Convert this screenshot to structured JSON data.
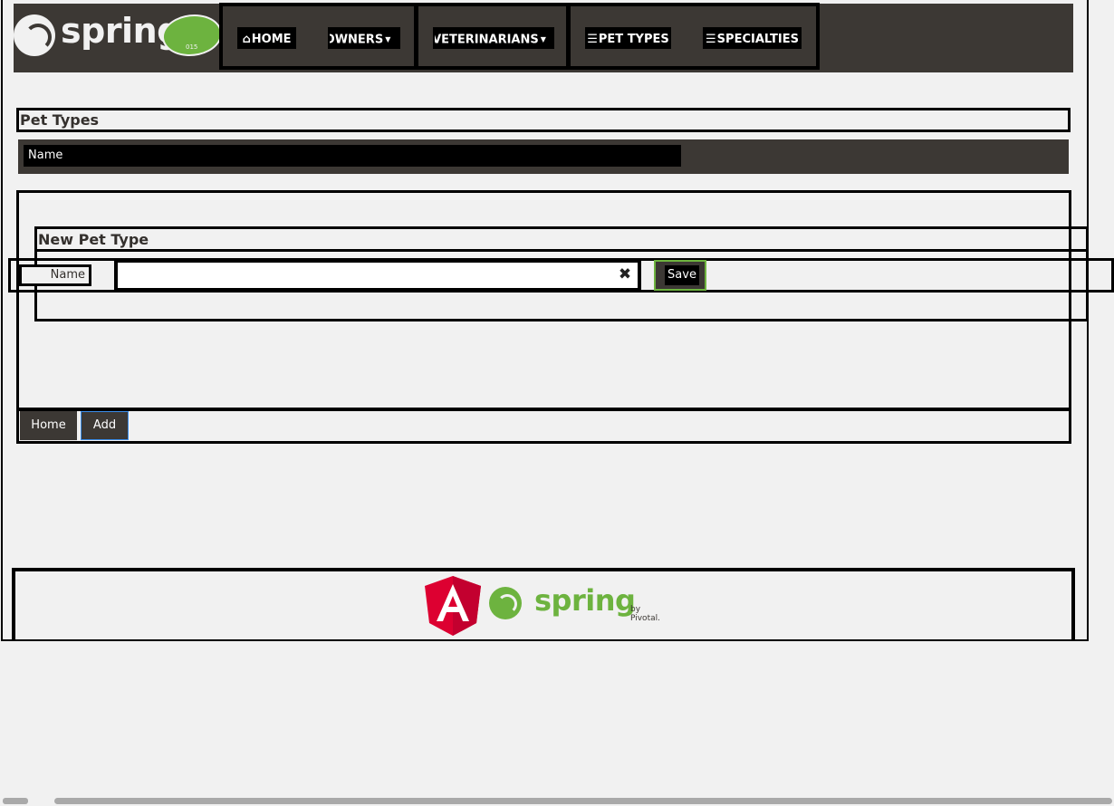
{
  "brand": {
    "name": "spring",
    "leaf_text": "015",
    "leaf_color": "#6db33f"
  },
  "nav": {
    "items": [
      {
        "label": "HOME",
        "icon": "home-icon"
      },
      {
        "label": "OWNERS",
        "icon": "chevron-down-icon"
      },
      {
        "label": "VETERINARIANS",
        "icon": "chevron-down-icon"
      },
      {
        "label": "PET TYPES",
        "icon": "list-icon"
      },
      {
        "label": "SPECIALTIES",
        "icon": "list-icon"
      }
    ]
  },
  "page": {
    "title": "Pet Types"
  },
  "table": {
    "columns": [
      "Name"
    ],
    "rows": []
  },
  "form": {
    "title": "New Pet Type",
    "name_label": "Name",
    "name_value": "",
    "clear_icon": "close-icon",
    "save_label": "Save"
  },
  "actions": {
    "home_label": "Home",
    "add_label": "Add"
  },
  "footer": {
    "angular_letter": "A",
    "spring_word": "spring",
    "pivotal_text": "by Pivotal."
  },
  "colors": {
    "dark": "#3c3834",
    "green": "#6db33f",
    "angular_red": "#dd0031",
    "background": "#f1f1f1"
  }
}
